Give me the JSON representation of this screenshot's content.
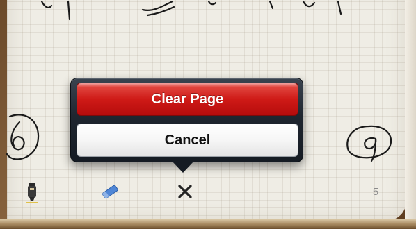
{
  "popover": {
    "clear_label": "Clear Page",
    "cancel_label": "Cancel"
  },
  "toolbar": {
    "page_number": "5",
    "tools": [
      {
        "icon": "marker-icon"
      },
      {
        "icon": "eraser-icon"
      },
      {
        "icon": "close-icon"
      }
    ]
  },
  "colors": {
    "danger": "#d11f1a",
    "popover_bg": "#1f2630",
    "paper": "#efede5",
    "ink": "#1a1a1a",
    "eraser": "#4f86d6"
  }
}
